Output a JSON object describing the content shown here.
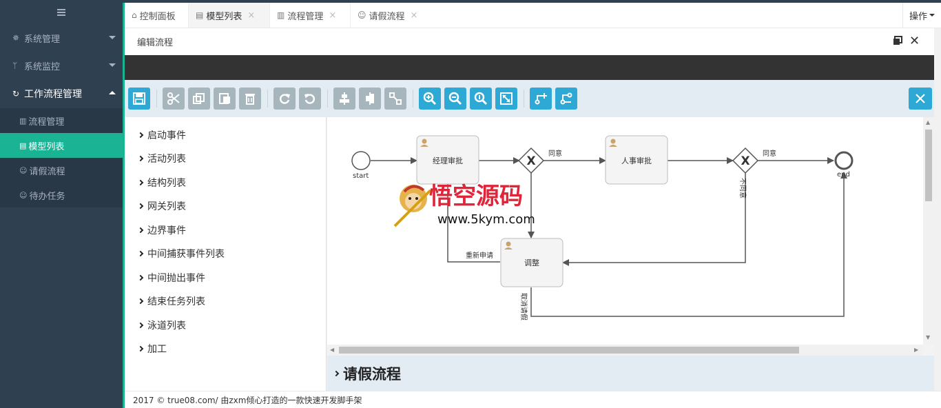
{
  "sidebar": {
    "menu": [
      {
        "label": "系统管理",
        "icon": "gear-icon"
      },
      {
        "label": "系统监控",
        "icon": "pulse-icon"
      },
      {
        "label": "工作流程管理",
        "icon": "cycle-icon"
      }
    ],
    "submenu": [
      {
        "label": "流程管理",
        "icon": "bank-icon"
      },
      {
        "label": "模型列表",
        "icon": "file-icon"
      },
      {
        "label": "请假流程",
        "icon": "smile-icon"
      },
      {
        "label": "待办任务",
        "icon": "smile-icon"
      }
    ]
  },
  "tabs": [
    {
      "label": "控制面板",
      "icon": "home-icon",
      "closable": false
    },
    {
      "label": "模型列表",
      "icon": "file-icon",
      "closable": true
    },
    {
      "label": "流程管理",
      "icon": "bank-icon",
      "closable": true
    },
    {
      "label": "请假流程",
      "icon": "smile-icon",
      "closable": true
    }
  ],
  "ops_label": "操作",
  "panel": {
    "title": "编辑流程"
  },
  "palette": [
    "启动事件",
    "活动列表",
    "结构列表",
    "网关列表",
    "边界事件",
    "中间捕获事件列表",
    "中间抛出事件",
    "结束任务列表",
    "泳道列表",
    "加工"
  ],
  "diagram": {
    "start_label": "start",
    "end_label": "end",
    "task1": "经理审批",
    "task2": "人事审批",
    "task3": "调整",
    "edge_agree1": "同意",
    "edge_agree2": "同意",
    "edge_disagree": "不同意",
    "edge_reapply": "重新申请",
    "edge_cancel": "取消请假"
  },
  "watermark": {
    "brand": "悟空源码",
    "url": "www.5kym.com"
  },
  "process_title": "请假流程",
  "footer": "2017 © true08.com/ 由zxm倾心打造的一款快速开发脚手架",
  "colors": {
    "sidebar": "#2f4050",
    "accent": "#1ab394",
    "toolbar_button": "#2ea9d6",
    "toolbar_bg": "#e3ebf3"
  }
}
